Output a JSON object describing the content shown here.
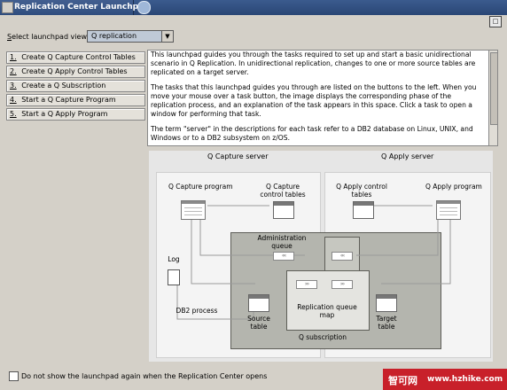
{
  "window": {
    "title": "Replication Center Launchpad"
  },
  "view": {
    "label": "Select launchpad view",
    "selected": "Q replication"
  },
  "tasks": [
    {
      "num": "1.",
      "label": "Create Q Capture Control Tables"
    },
    {
      "num": "2.",
      "label": "Create Q Apply Control Tables"
    },
    {
      "num": "3.",
      "label": "Create a Q Subscription"
    },
    {
      "num": "4.",
      "label": "Start a Q Capture Program"
    },
    {
      "num": "5.",
      "label": "Start a Q Apply Program"
    }
  ],
  "description": {
    "p1": "This launchpad guides you through the tasks required to set up and start a basic unidirectional scenario in Q Replication. In unidirectional replication, changes to one or more source tables are replicated on a target server.",
    "p2": "The tasks that this launchpad guides you through are listed on the buttons to the left. When you move your mouse over a task button, the image displays the corresponding phase of the replication process, and an explanation of the task appears in this space. Click a task to open a window for performing that task.",
    "p3": "The term \"server\" in the descriptions for each task refer to a DB2 database on Linux, UNIX, and Windows or to a DB2 subsystem on z/OS."
  },
  "diagram": {
    "capture_server": "Q Capture server",
    "apply_server": "Q Apply server",
    "capture_program": "Q Capture program",
    "capture_control": "Q Capture control tables",
    "apply_control": "Q Apply control tables",
    "apply_program": "Q Apply program",
    "admin_queue": "Administration queue",
    "log": "Log",
    "db2_process": "DB2 process",
    "source_table": "Source table",
    "rq_map": "Replication queue map",
    "target_table": "Target table",
    "q_subscription": "Q subscription"
  },
  "footer": {
    "checkbox_label": "Do not show the launchpad again when the Replication Center opens",
    "checked": false
  },
  "watermark": {
    "brand": "智可网",
    "url": "www.hzhike.com"
  },
  "colors": {
    "titlebar": "#2f4d7e",
    "diagram_shade": "#b4b5ae",
    "watermark": "#c8202a"
  }
}
